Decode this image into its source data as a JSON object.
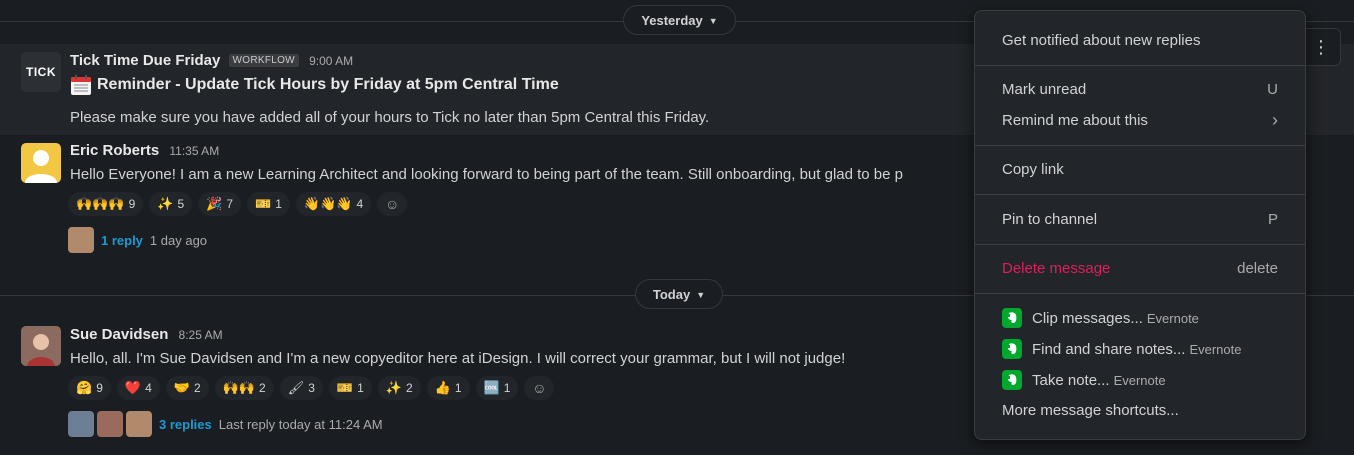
{
  "dividers": {
    "yesterday_label": "Yesterday",
    "today_label": "Today"
  },
  "messages": [
    {
      "sender": "Tick Time Due Friday",
      "badge": "WORKFLOW",
      "time": "9:00 AM",
      "avatar_text": "TICK",
      "title": "Reminder - Update Tick Hours by Friday at 5pm Central Time",
      "text": "Please make sure you have added all of your hours to Tick no later than 5pm Central this Friday."
    },
    {
      "sender": "Eric Roberts",
      "time": "11:35 AM",
      "text": "Hello Everyone! I am a new Learning Architect and looking forward to being part of the team. Still onboarding, but glad to be p",
      "reactions": [
        {
          "emoji": "🙌🙌🙌",
          "count": "9"
        },
        {
          "emoji": "✨",
          "count": "5"
        },
        {
          "emoji": "🎉",
          "count": "7"
        },
        {
          "emoji": "🎫",
          "count": "1"
        },
        {
          "emoji": "👋👋👋",
          "count": "4"
        }
      ],
      "thread": {
        "link": "1 reply",
        "meta": "1 day ago"
      }
    },
    {
      "sender": "Sue Davidsen",
      "time": "8:25 AM",
      "text": "Hello, all. I'm Sue Davidsen and I'm a new copyeditor here at iDesign. I will correct your grammar, but I will not judge!",
      "reactions": [
        {
          "emoji": "🤗",
          "count": "9"
        },
        {
          "emoji": "❤️",
          "count": "4"
        },
        {
          "emoji": "🤝",
          "count": "2"
        },
        {
          "emoji": "🙌🙌",
          "count": "2"
        },
        {
          "emoji": "🖌",
          "count": "3"
        },
        {
          "emoji": "🎫",
          "count": "1"
        },
        {
          "emoji": "✨",
          "count": "2"
        },
        {
          "emoji": "👍",
          "count": "1"
        },
        {
          "emoji": "🆒",
          "count": "1"
        }
      ],
      "thread": {
        "link": "3 replies",
        "meta": "Last reply today at 11:24 AM"
      }
    }
  ],
  "context_menu": {
    "notify": "Get notified about new replies",
    "mark_unread": "Mark unread",
    "mark_unread_key": "U",
    "remind": "Remind me about this",
    "remind_arrow": "›",
    "copy_link": "Copy link",
    "pin": "Pin to channel",
    "pin_key": "P",
    "delete": "Delete message",
    "delete_key": "delete",
    "clip": "Clip messages...",
    "find": "Find and share notes...",
    "take_note": "Take note...",
    "app_name": "Evernote",
    "more": "More message shortcuts..."
  },
  "colors": {
    "background": "#1a1d21",
    "link": "#1d9bd1",
    "danger": "#e01e5a",
    "evernote": "#00a82d"
  }
}
